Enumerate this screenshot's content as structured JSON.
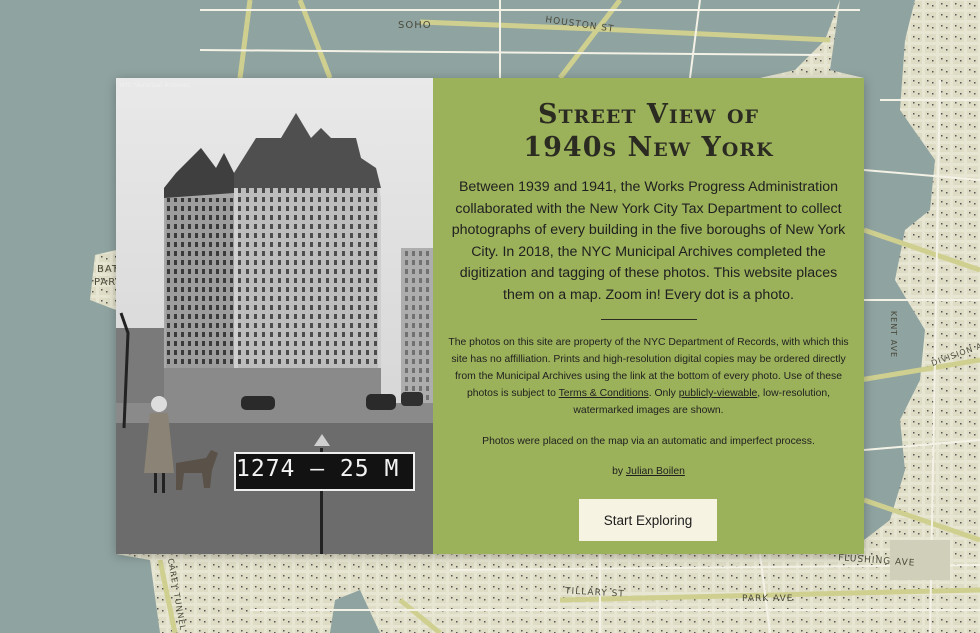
{
  "map": {
    "labels": {
      "soho": "SOHO",
      "houston": "HOUSTON ST",
      "battery_1": "BAT",
      "battery_2": "PAR",
      "flushing": "FLUSHING AVE",
      "tillary": "TILLARY ST",
      "park_ave": "PARK AVE",
      "kent_ave": "KENT AVE",
      "division": "DIVISION A",
      "tunnel": "CAREY TUNNEL"
    }
  },
  "photo": {
    "sign_text": "1274 – 25   M",
    "watermark": "NYC Municipal Archives"
  },
  "panel": {
    "title_line1": "Street View of",
    "title_line2": "1940s New York",
    "intro": "Between 1939 and 1941, the Works Progress Administration collaborated with the New York City Tax Department to collect photographs of every building in the five boroughs of New York City. In 2018, the NYC Municipal Archives completed the digitization and tagging of these photos. This website places them on a map. Zoom in! Every dot is a photo.",
    "fine_1": "The photos on this site are property of the NYC Department of Records, with which this site has no affilliation. Prints and high-resolution digital copies may be ordered directly from the Municipal Archives using the link at the bottom of every photo. Use of these photos is subject to",
    "terms_link": "Terms & Conditions",
    "fine_2": ". Only",
    "viewable_link": "publicly-viewable",
    "fine_3": ", low-resolution, watermarked images are shown.",
    "note": "Photos were placed on the map via an automatic and imperfect process.",
    "by_prefix": "by",
    "author": "Julian Boilen",
    "start_button": "Start Exploring"
  }
}
